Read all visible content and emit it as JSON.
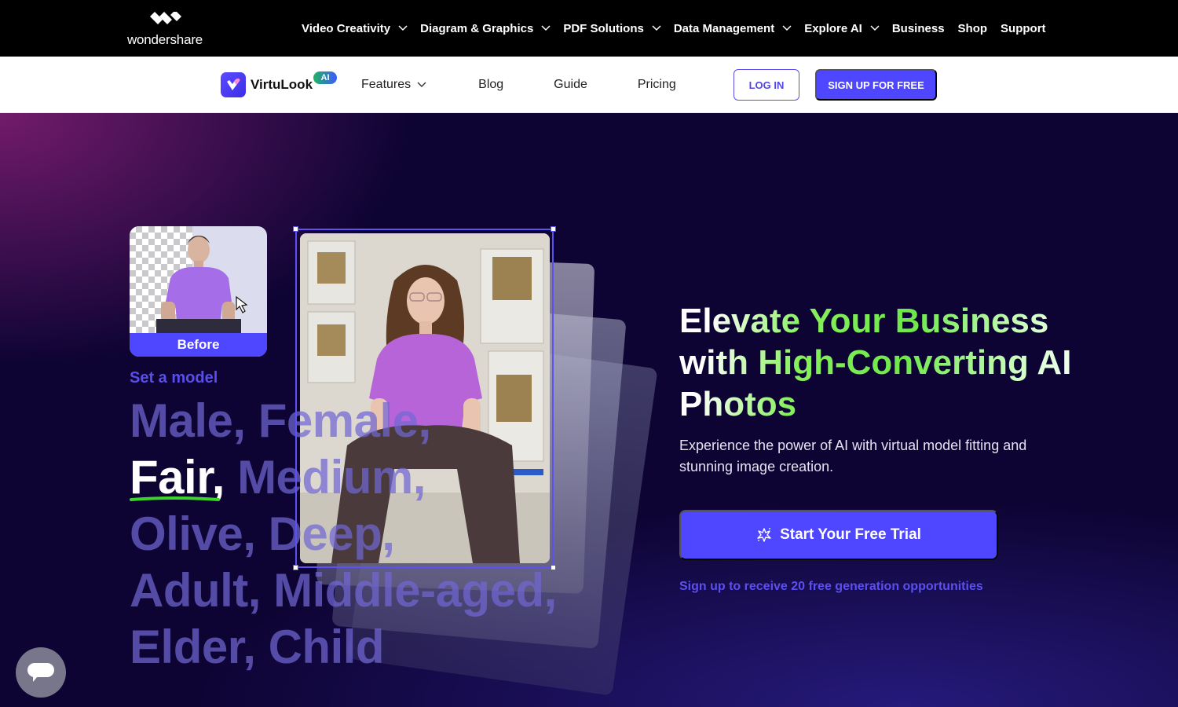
{
  "global_nav": {
    "brand": "wondershare",
    "items": [
      {
        "label": "Video Creativity",
        "has_dropdown": true
      },
      {
        "label": "Diagram & Graphics",
        "has_dropdown": true
      },
      {
        "label": "PDF Solutions",
        "has_dropdown": true
      },
      {
        "label": "Data Management",
        "has_dropdown": true
      },
      {
        "label": "Explore AI",
        "has_dropdown": true
      },
      {
        "label": "Business",
        "has_dropdown": false
      },
      {
        "label": "Shop",
        "has_dropdown": false
      },
      {
        "label": "Support",
        "has_dropdown": false
      }
    ]
  },
  "product_nav": {
    "product_name": "VirtuLook",
    "badge": "AI",
    "links": [
      {
        "label": "Features",
        "has_dropdown": true
      },
      {
        "label": "Blog",
        "has_dropdown": false
      },
      {
        "label": "Guide",
        "has_dropdown": false
      },
      {
        "label": "Pricing",
        "has_dropdown": false
      }
    ],
    "login_label": "LOG IN",
    "signup_label": "SIGN UP FOR FREE"
  },
  "hero": {
    "before_label": "Before",
    "set_model_label": "Set a model",
    "attribute_lines": [
      {
        "text": "Male, Female,",
        "highlight": ""
      },
      {
        "text": " Medium,",
        "highlight": "Fair,"
      },
      {
        "text": "Olive, Deep,",
        "highlight": ""
      },
      {
        "text": "Adult, Middle-aged,",
        "highlight": ""
      },
      {
        "text": "Elder, Child",
        "highlight": ""
      }
    ],
    "headline": "Elevate Your Business with High-Converting AI Photos",
    "subtext": "Experience the power of AI with virtual model fitting and stunning image creation.",
    "cta_label": "Start Your Free Trial",
    "cta_icon": "sparkle-icon",
    "cta_note": "Sign up to receive 20 free generation opportunities"
  },
  "colors": {
    "accent": "#4f46ff",
    "headline_green": "#7ff05a",
    "background_dark": "#0e0434",
    "muted_attr_text": "#7066d2"
  },
  "chat_widget": {
    "icon": "chat-bubble-icon"
  }
}
